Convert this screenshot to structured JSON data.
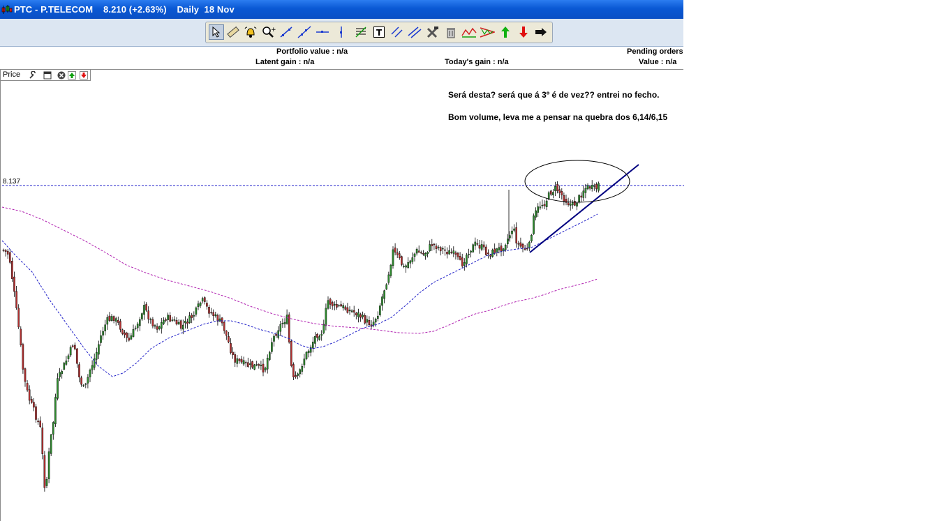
{
  "window": {
    "title": "PTC - P.TELECOM    8.210 (+2.63%)    Daily  18 Nov"
  },
  "toolbar": {
    "tools": [
      {
        "name": "pointer-icon",
        "selected": true
      },
      {
        "name": "ruler-icon"
      },
      {
        "name": "alarm-bell-icon"
      },
      {
        "name": "zoom-icon"
      },
      {
        "name": "line-icon"
      },
      {
        "name": "ray-line-icon"
      },
      {
        "name": "horizontal-line-icon"
      },
      {
        "name": "vertical-line-icon"
      },
      {
        "name": "fibonacci-icon"
      },
      {
        "name": "text-tool-icon"
      },
      {
        "name": "parallel-lines-icon"
      },
      {
        "name": "channel-icon"
      },
      {
        "name": "tools-icon"
      },
      {
        "name": "trash-icon"
      },
      {
        "name": "pattern-icon"
      },
      {
        "name": "triangle-pattern-icon"
      },
      {
        "name": "buy-arrow-icon"
      },
      {
        "name": "sell-arrow-icon"
      },
      {
        "name": "right-arrow-icon"
      }
    ]
  },
  "infobar": {
    "portfolio_value": "Portfolio value : n/a",
    "latent_gain": "Latent gain : n/a",
    "todays_gain": "Today's gain : n/a",
    "pending_orders": "Pending orders",
    "value": "Value : n/a"
  },
  "panel": {
    "label": "Price"
  },
  "annotation": {
    "line1": "Será desta? será que á 3º é de vez?? entrei no fecho.",
    "line2": "Bom volume, leva me a pensar na quebra dos 6,14/6,15"
  },
  "price_line": {
    "label": "8.137"
  },
  "colors": {
    "titlebar": "#0a58d4",
    "bull_candle": "#2e8b2e",
    "bear_candle": "#b03030",
    "ma_short": "#1f1fc8",
    "ma_long": "#b020b0",
    "trendline": "#000080"
  }
}
